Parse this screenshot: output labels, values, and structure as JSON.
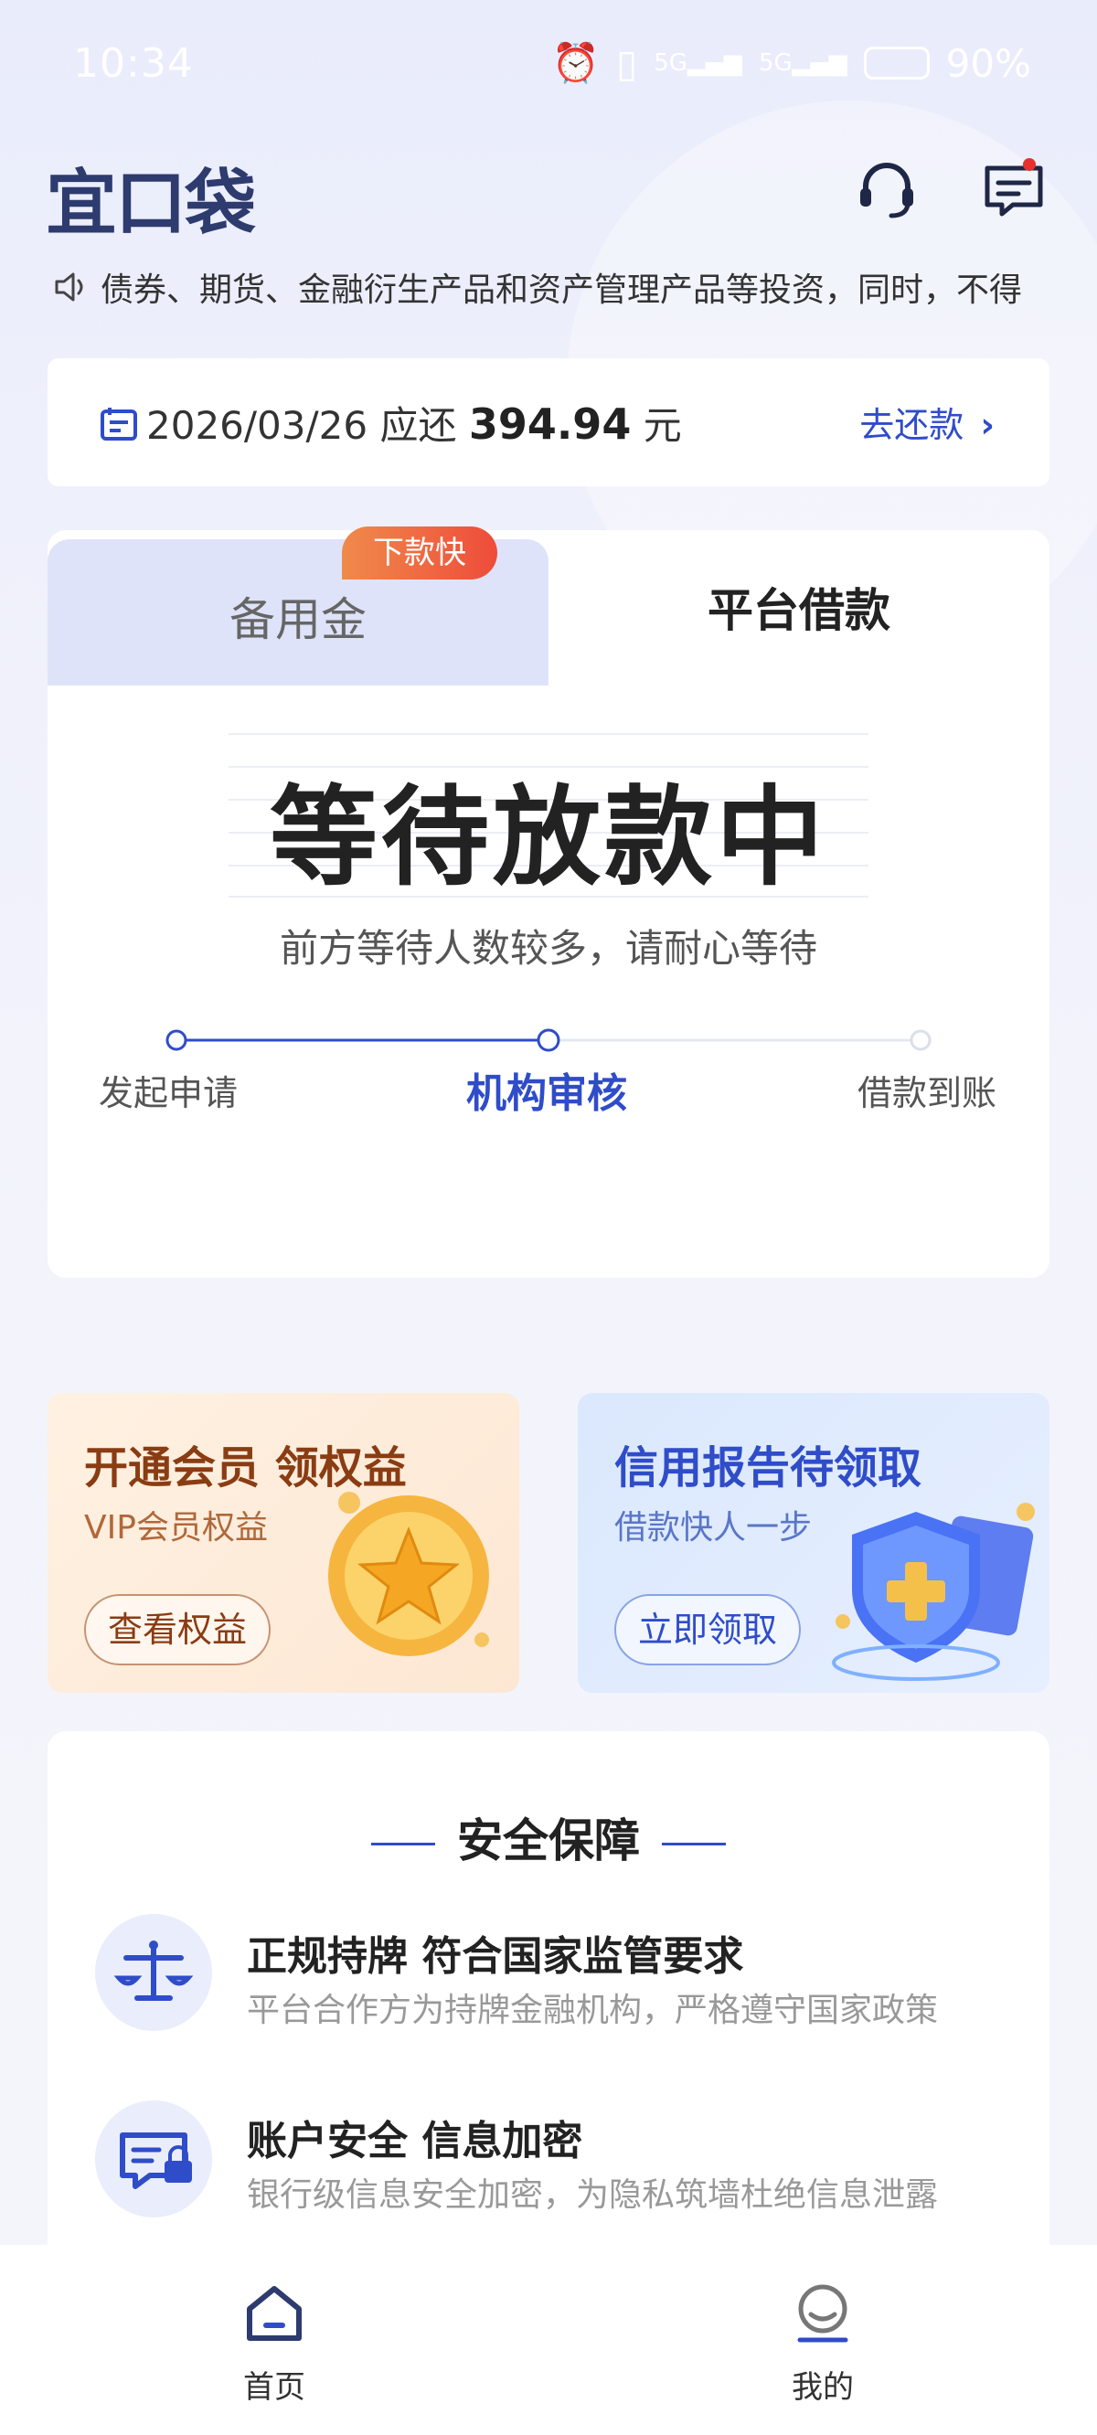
{
  "status_bar": {
    "time": "10:34",
    "battery": "90%",
    "signal_1": "5G",
    "signal_2": "5G"
  },
  "header": {
    "logo_text": "宜口袋"
  },
  "notice": {
    "text": "债券、期货、金融衍生产品和资产管理产品等投资，同时，不得"
  },
  "repay": {
    "date": "2026/03/26",
    "due_label": "应还",
    "amount": "394.94",
    "unit": "元",
    "action": "去还款"
  },
  "loan_tabs": {
    "left": "备用金",
    "right": "平台借款",
    "badge": "下款快"
  },
  "loan_status": {
    "title": "等待放款中",
    "subtitle": "前方等待人数较多，请耐心等待",
    "steps": [
      "发起申请",
      "机构审核",
      "借款到账"
    ],
    "current_step": 2
  },
  "promos": [
    {
      "title": "开通会员 领权益",
      "subtitle": "VIP会员权益",
      "button": "查看权益"
    },
    {
      "title": "信用报告待领取",
      "subtitle": "借款快人一步",
      "button": "立即领取"
    }
  ],
  "security": {
    "title": "安全保障",
    "items": [
      {
        "title": "正规持牌 符合国家监管要求",
        "desc": "平台合作方为持牌金融机构，严格遵守国家政策",
        "icon": "scale-icon"
      },
      {
        "title": "账户安全 信息加密",
        "desc": "银行级信息安全加密，为隐私筑墙杜绝信息泄露",
        "icon": "secure-chat-icon"
      }
    ]
  },
  "bottom_nav": [
    {
      "label": "首页",
      "icon": "home-icon",
      "active": true
    },
    {
      "label": "我的",
      "icon": "profile-icon",
      "active": false
    }
  ],
  "colors": {
    "accent": "#2f4cc9",
    "badge": "#ee4c3a",
    "bg": "#eef0fb"
  }
}
